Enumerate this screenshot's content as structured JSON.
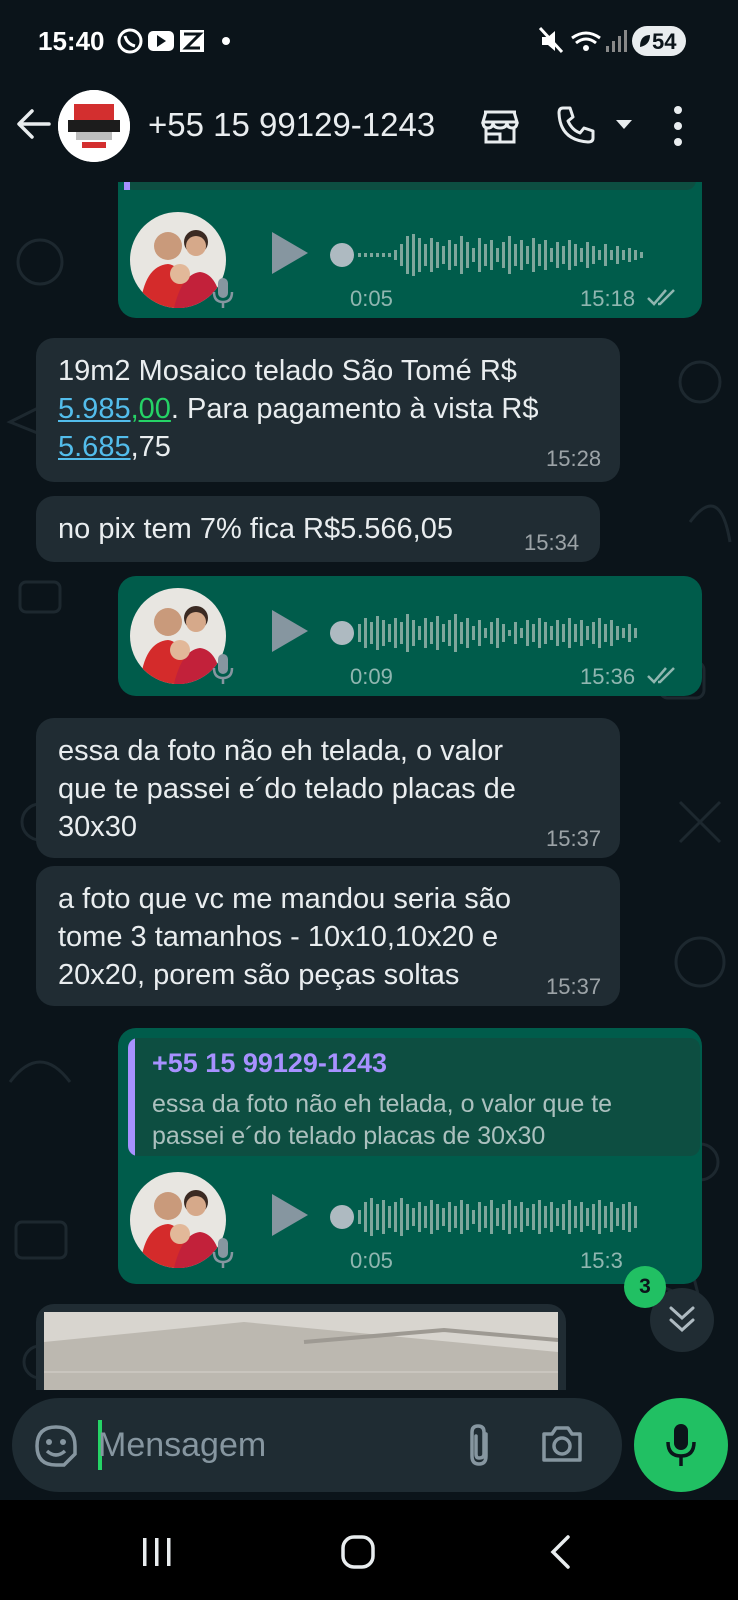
{
  "status_bar": {
    "time": "15:40",
    "battery": "54"
  },
  "header": {
    "title": "+55 15 99129-1243"
  },
  "messages": [
    {
      "type": "voice",
      "direction": "outgoing",
      "duration": "0:05",
      "time": "15:18",
      "status": "read"
    },
    {
      "type": "text",
      "direction": "incoming",
      "line1": "19m2 Mosaico telado São Tomé R$",
      "line2_price1_int": "5.985",
      "line2_price1_sep": ",",
      "line2_price1_cents": "00",
      "line2_rest": ". Para pagamento à vista R$",
      "line3_price2_int": "5.685",
      "line3_rest": ",75",
      "time": "15:28"
    },
    {
      "type": "text",
      "direction": "incoming",
      "lines": [
        "no pix tem 7% fica R$5.566,05"
      ],
      "time": "15:34"
    },
    {
      "type": "voice",
      "direction": "outgoing",
      "duration": "0:09",
      "time": "15:36",
      "status": "read"
    },
    {
      "type": "text",
      "direction": "incoming",
      "lines": [
        "essa da foto não eh telada, o valor",
        "que te passei e´do telado placas de",
        "30x30"
      ],
      "time": "15:37"
    },
    {
      "type": "text",
      "direction": "incoming",
      "lines": [
        "a foto que vc me mandou seria são",
        "tome 3 tamanhos - 10x10,10x20 e",
        "20x20, porem são peças soltas"
      ],
      "time": "15:37"
    },
    {
      "type": "voice_reply",
      "direction": "outgoing",
      "quote_name": "+55 15 99129-1243",
      "quote_lines": [
        "essa da foto não eh telada, o valor que te",
        "passei e´do telado placas de 30x30"
      ],
      "duration": "0:05",
      "time": "15:3"
    },
    {
      "type": "image",
      "direction": "incoming"
    }
  ],
  "scroll_down": {
    "unread_count": "3"
  },
  "input": {
    "placeholder": "Mensagem"
  },
  "colors": {
    "outgoing": "#005c4b",
    "incoming": "#202c33",
    "accent": "#21c063",
    "link": "#53bdeb"
  },
  "icons": [
    "back-arrow-icon",
    "store-icon",
    "phone-icon",
    "chevron-down-icon",
    "more-vertical-icon",
    "play-icon",
    "mic-icon",
    "double-check-icon",
    "emoji-icon",
    "attach-icon",
    "camera-icon",
    "double-chevron-down-icon"
  ]
}
